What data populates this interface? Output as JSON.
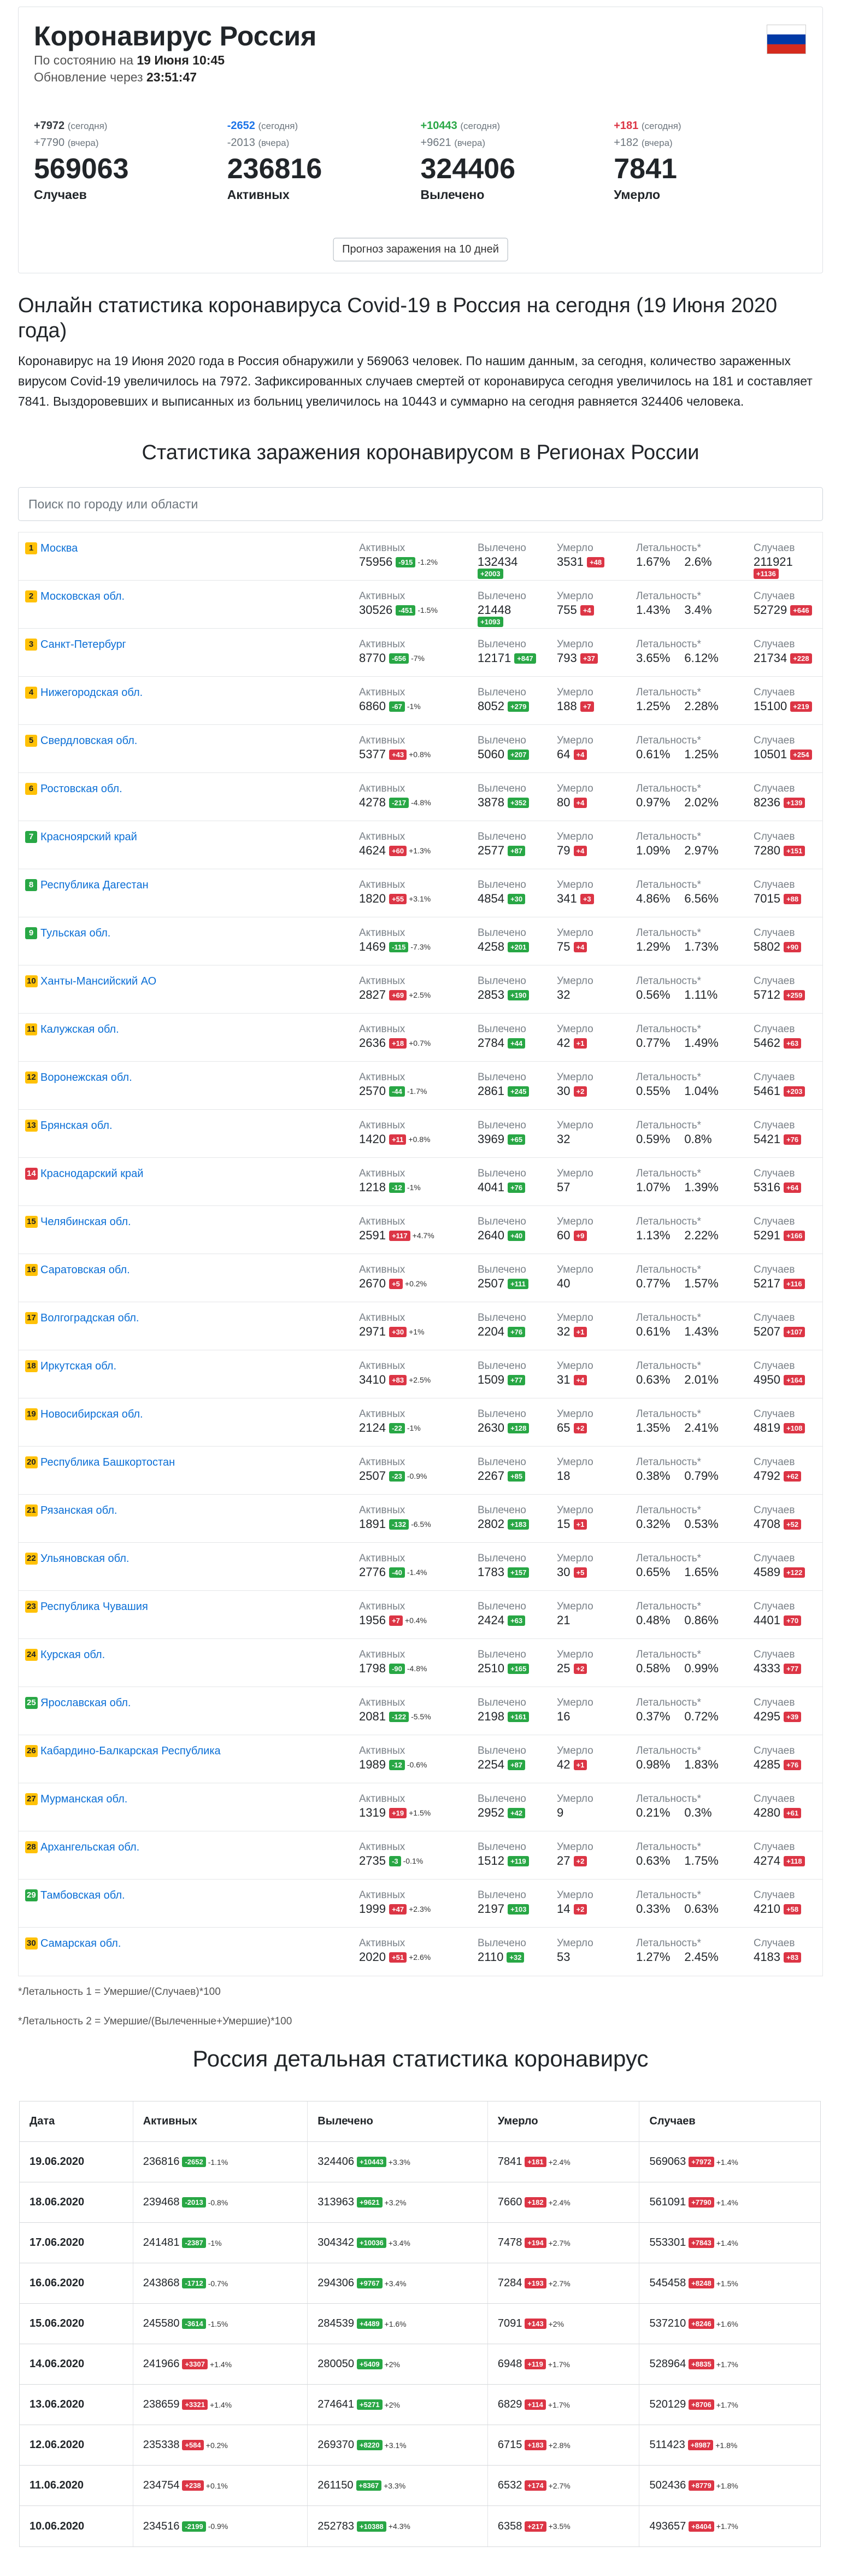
{
  "header": {
    "title": "Коронавирус Россия",
    "as_of_prefix": "По состоянию на",
    "as_of_value": "19 Июня 10:45",
    "update_prefix": "Обновление через",
    "update_value": "23:51:47",
    "flag_colors": [
      "#ffffff",
      "#0039a6",
      "#d52b1e"
    ]
  },
  "stats": [
    {
      "today": "+7972",
      "today_tag": "(сегодня)",
      "yesterday": "+7790",
      "yesterday_tag": "(вчера)",
      "total": "569063",
      "label": "Случаев",
      "color": "#343a40"
    },
    {
      "today": "-2652",
      "today_tag": "(сегодня)",
      "yesterday": "-2013",
      "yesterday_tag": "(вчера)",
      "total": "236816",
      "label": "Активных",
      "color": "#1a73e8"
    },
    {
      "today": "+10443",
      "today_tag": "(сегодня)",
      "yesterday": "+9621",
      "yesterday_tag": "(вчера)",
      "total": "324406",
      "label": "Вылечено",
      "color": "#28a745"
    },
    {
      "today": "+181",
      "today_tag": "(сегодня)",
      "yesterday": "+182",
      "yesterday_tag": "(вчера)",
      "total": "7841",
      "label": "Умерло",
      "color": "#dc3545"
    }
  ],
  "forecast_button": "Прогноз заражения на 10 дней",
  "description": {
    "title": "Онлайн статистика коронавируса Covid-19 в Россия на сегодня (19 Июня 2020 года)",
    "text": "Коронавирус на 19 Июня 2020 года в Россия обнаружили у 569063 человек. По нашим данным, за сегодня, количество зараженных вирусом Covid-19 увеличилось на 7972. Зафиксированных случаев смертей от коронавируса сегодня увеличилось на 181 и составляет 7841. Выздоровевших и выписанных из больниц увеличилось на 10443 и суммарно на сегодня равняется 324406 человека."
  },
  "regions_title": "Статистика заражения коронавирусом в Регионах России",
  "search": {
    "placeholder": "Поиск по городу или области"
  },
  "region_labels": {
    "active": "Активных",
    "recovered": "Вылечено",
    "died": "Умерло",
    "lethality": "Летальность*",
    "cases": "Случаев"
  },
  "regions": [
    {
      "rank": "1",
      "rank_color": "yellow",
      "name": "Москва",
      "active": "75956",
      "active_delta": "-915",
      "active_sign": "g",
      "active_pct": "-1.2%",
      "recovered": "132434",
      "recovered_delta": "+2003",
      "recovered_wrap": true,
      "died": "3531",
      "died_delta": "+48",
      "leth1": "1.67%",
      "leth2": "2.6%",
      "cases": "211921",
      "cases_delta": "+1136",
      "cases_wrap": true
    },
    {
      "rank": "2",
      "rank_color": "yellow",
      "name": "Московская обл.",
      "active": "30526",
      "active_delta": "-451",
      "active_sign": "g",
      "active_pct": "-1.5%",
      "recovered": "21448",
      "recovered_delta": "+1093",
      "recovered_wrap": true,
      "died": "755",
      "died_delta": "+4",
      "leth1": "1.43%",
      "leth2": "3.4%",
      "cases": "52729",
      "cases_delta": "+646",
      "cases_wrap": false
    },
    {
      "rank": "3",
      "rank_color": "yellow",
      "name": "Санкт-Петербург",
      "active": "8770",
      "active_delta": "-656",
      "active_sign": "g",
      "active_pct": "-7%",
      "recovered": "12171",
      "recovered_delta": "+847",
      "recovered_wrap": false,
      "died": "793",
      "died_delta": "+37",
      "leth1": "3.65%",
      "leth2": "6.12%",
      "cases": "21734",
      "cases_delta": "+228",
      "cases_wrap": false
    },
    {
      "rank": "4",
      "rank_color": "yellow",
      "name": "Нижегородская обл.",
      "active": "6860",
      "active_delta": "-67",
      "active_sign": "g",
      "active_pct": "-1%",
      "recovered": "8052",
      "recovered_delta": "+279",
      "recovered_wrap": false,
      "died": "188",
      "died_delta": "+7",
      "leth1": "1.25%",
      "leth2": "2.28%",
      "cases": "15100",
      "cases_delta": "+219",
      "cases_wrap": false
    },
    {
      "rank": "5",
      "rank_color": "yellow",
      "name": "Свердловская обл.",
      "active": "5377",
      "active_delta": "+43",
      "active_sign": "r",
      "active_pct": "+0.8%",
      "recovered": "5060",
      "recovered_delta": "+207",
      "recovered_wrap": false,
      "died": "64",
      "died_delta": "+4",
      "leth1": "0.61%",
      "leth2": "1.25%",
      "cases": "10501",
      "cases_delta": "+254",
      "cases_wrap": false
    },
    {
      "rank": "6",
      "rank_color": "yellow",
      "name": "Ростовская обл.",
      "active": "4278",
      "active_delta": "-217",
      "active_sign": "g",
      "active_pct": "-4.8%",
      "recovered": "3878",
      "recovered_delta": "+352",
      "recovered_wrap": false,
      "died": "80",
      "died_delta": "+4",
      "leth1": "0.97%",
      "leth2": "2.02%",
      "cases": "8236",
      "cases_delta": "+139",
      "cases_wrap": false
    },
    {
      "rank": "7",
      "rank_color": "green",
      "name": "Красноярский край",
      "active": "4624",
      "active_delta": "+60",
      "active_sign": "r",
      "active_pct": "+1.3%",
      "recovered": "2577",
      "recovered_delta": "+87",
      "recovered_wrap": false,
      "died": "79",
      "died_delta": "+4",
      "leth1": "1.09%",
      "leth2": "2.97%",
      "cases": "7280",
      "cases_delta": "+151",
      "cases_wrap": false
    },
    {
      "rank": "8",
      "rank_color": "green",
      "name": "Республика Дагестан",
      "active": "1820",
      "active_delta": "+55",
      "active_sign": "r",
      "active_pct": "+3.1%",
      "recovered": "4854",
      "recovered_delta": "+30",
      "recovered_wrap": false,
      "died": "341",
      "died_delta": "+3",
      "leth1": "4.86%",
      "leth2": "6.56%",
      "cases": "7015",
      "cases_delta": "+88",
      "cases_wrap": false
    },
    {
      "rank": "9",
      "rank_color": "green",
      "name": "Тульская обл.",
      "active": "1469",
      "active_delta": "-115",
      "active_sign": "g",
      "active_pct": "-7.3%",
      "recovered": "4258",
      "recovered_delta": "+201",
      "recovered_wrap": false,
      "died": "75",
      "died_delta": "+4",
      "leth1": "1.29%",
      "leth2": "1.73%",
      "cases": "5802",
      "cases_delta": "+90",
      "cases_wrap": false
    },
    {
      "rank": "10",
      "rank_color": "yellow",
      "name": "Ханты-Мансийский АО",
      "active": "2827",
      "active_delta": "+69",
      "active_sign": "r",
      "active_pct": "+2.5%",
      "recovered": "2853",
      "recovered_delta": "+190",
      "recovered_wrap": false,
      "died": "32",
      "died_delta": "",
      "leth1": "0.56%",
      "leth2": "1.11%",
      "cases": "5712",
      "cases_delta": "+259",
      "cases_wrap": false
    },
    {
      "rank": "11",
      "rank_color": "yellow",
      "name": "Калужская обл.",
      "active": "2636",
      "active_delta": "+18",
      "active_sign": "r",
      "active_pct": "+0.7%",
      "recovered": "2784",
      "recovered_delta": "+44",
      "recovered_wrap": false,
      "died": "42",
      "died_delta": "+1",
      "leth1": "0.77%",
      "leth2": "1.49%",
      "cases": "5462",
      "cases_delta": "+63",
      "cases_wrap": false
    },
    {
      "rank": "12",
      "rank_color": "yellow",
      "name": "Воронежская обл.",
      "active": "2570",
      "active_delta": "-44",
      "active_sign": "g",
      "active_pct": "-1.7%",
      "recovered": "2861",
      "recovered_delta": "+245",
      "recovered_wrap": false,
      "died": "30",
      "died_delta": "+2",
      "leth1": "0.55%",
      "leth2": "1.04%",
      "cases": "5461",
      "cases_delta": "+203",
      "cases_wrap": false
    },
    {
      "rank": "13",
      "rank_color": "yellow",
      "name": "Брянская обл.",
      "active": "1420",
      "active_delta": "+11",
      "active_sign": "r",
      "active_pct": "+0.8%",
      "recovered": "3969",
      "recovered_delta": "+65",
      "recovered_wrap": false,
      "died": "32",
      "died_delta": "",
      "leth1": "0.59%",
      "leth2": "0.8%",
      "cases": "5421",
      "cases_delta": "+76",
      "cases_wrap": false
    },
    {
      "rank": "14",
      "rank_color": "red",
      "name": "Краснодарский край",
      "active": "1218",
      "active_delta": "-12",
      "active_sign": "g",
      "active_pct": "-1%",
      "recovered": "4041",
      "recovered_delta": "+76",
      "recovered_wrap": false,
      "died": "57",
      "died_delta": "",
      "leth1": "1.07%",
      "leth2": "1.39%",
      "cases": "5316",
      "cases_delta": "+64",
      "cases_wrap": false
    },
    {
      "rank": "15",
      "rank_color": "yellow",
      "name": "Челябинская обл.",
      "active": "2591",
      "active_delta": "+117",
      "active_sign": "r",
      "active_pct": "+4.7%",
      "recovered": "2640",
      "recovered_delta": "+40",
      "recovered_wrap": false,
      "died": "60",
      "died_delta": "+9",
      "leth1": "1.13%",
      "leth2": "2.22%",
      "cases": "5291",
      "cases_delta": "+166",
      "cases_wrap": false
    },
    {
      "rank": "16",
      "rank_color": "yellow",
      "name": "Саратовская обл.",
      "active": "2670",
      "active_delta": "+5",
      "active_sign": "r",
      "active_pct": "+0.2%",
      "recovered": "2507",
      "recovered_delta": "+111",
      "recovered_wrap": false,
      "died": "40",
      "died_delta": "",
      "leth1": "0.77%",
      "leth2": "1.57%",
      "cases": "5217",
      "cases_delta": "+116",
      "cases_wrap": false
    },
    {
      "rank": "17",
      "rank_color": "yellow",
      "name": "Волгоградская обл.",
      "active": "2971",
      "active_delta": "+30",
      "active_sign": "r",
      "active_pct": "+1%",
      "recovered": "2204",
      "recovered_delta": "+76",
      "recovered_wrap": false,
      "died": "32",
      "died_delta": "+1",
      "leth1": "0.61%",
      "leth2": "1.43%",
      "cases": "5207",
      "cases_delta": "+107",
      "cases_wrap": false
    },
    {
      "rank": "18",
      "rank_color": "yellow",
      "name": "Иркутская обл.",
      "active": "3410",
      "active_delta": "+83",
      "active_sign": "r",
      "active_pct": "+2.5%",
      "recovered": "1509",
      "recovered_delta": "+77",
      "recovered_wrap": false,
      "died": "31",
      "died_delta": "+4",
      "leth1": "0.63%",
      "leth2": "2.01%",
      "cases": "4950",
      "cases_delta": "+164",
      "cases_wrap": false
    },
    {
      "rank": "19",
      "rank_color": "yellow",
      "name": "Новосибирская обл.",
      "active": "2124",
      "active_delta": "-22",
      "active_sign": "g",
      "active_pct": "-1%",
      "recovered": "2630",
      "recovered_delta": "+128",
      "recovered_wrap": false,
      "died": "65",
      "died_delta": "+2",
      "leth1": "1.35%",
      "leth2": "2.41%",
      "cases": "4819",
      "cases_delta": "+108",
      "cases_wrap": false
    },
    {
      "rank": "20",
      "rank_color": "yellow",
      "name": "Республика Башкортостан",
      "active": "2507",
      "active_delta": "-23",
      "active_sign": "g",
      "active_pct": "-0.9%",
      "recovered": "2267",
      "recovered_delta": "+85",
      "recovered_wrap": false,
      "died": "18",
      "died_delta": "",
      "leth1": "0.38%",
      "leth2": "0.79%",
      "cases": "4792",
      "cases_delta": "+62",
      "cases_wrap": false
    },
    {
      "rank": "21",
      "rank_color": "yellow",
      "name": "Рязанская обл.",
      "active": "1891",
      "active_delta": "-132",
      "active_sign": "g",
      "active_pct": "-6.5%",
      "recovered": "2802",
      "recovered_delta": "+183",
      "recovered_wrap": false,
      "died": "15",
      "died_delta": "+1",
      "leth1": "0.32%",
      "leth2": "0.53%",
      "cases": "4708",
      "cases_delta": "+52",
      "cases_wrap": false
    },
    {
      "rank": "22",
      "rank_color": "yellow",
      "name": "Ульяновская обл.",
      "active": "2776",
      "active_delta": "-40",
      "active_sign": "g",
      "active_pct": "-1.4%",
      "recovered": "1783",
      "recovered_delta": "+157",
      "recovered_wrap": false,
      "died": "30",
      "died_delta": "+5",
      "leth1": "0.65%",
      "leth2": "1.65%",
      "cases": "4589",
      "cases_delta": "+122",
      "cases_wrap": false
    },
    {
      "rank": "23",
      "rank_color": "yellow",
      "name": "Республика Чувашия",
      "active": "1956",
      "active_delta": "+7",
      "active_sign": "r",
      "active_pct": "+0.4%",
      "recovered": "2424",
      "recovered_delta": "+63",
      "recovered_wrap": false,
      "died": "21",
      "died_delta": "",
      "leth1": "0.48%",
      "leth2": "0.86%",
      "cases": "4401",
      "cases_delta": "+70",
      "cases_wrap": false
    },
    {
      "rank": "24",
      "rank_color": "yellow",
      "name": "Курская обл.",
      "active": "1798",
      "active_delta": "-90",
      "active_sign": "g",
      "active_pct": "-4.8%",
      "recovered": "2510",
      "recovered_delta": "+165",
      "recovered_wrap": false,
      "died": "25",
      "died_delta": "+2",
      "leth1": "0.58%",
      "leth2": "0.99%",
      "cases": "4333",
      "cases_delta": "+77",
      "cases_wrap": false
    },
    {
      "rank": "25",
      "rank_color": "green",
      "name": "Ярославская обл.",
      "active": "2081",
      "active_delta": "-122",
      "active_sign": "g",
      "active_pct": "-5.5%",
      "recovered": "2198",
      "recovered_delta": "+161",
      "recovered_wrap": false,
      "died": "16",
      "died_delta": "",
      "leth1": "0.37%",
      "leth2": "0.72%",
      "cases": "4295",
      "cases_delta": "+39",
      "cases_wrap": false
    },
    {
      "rank": "26",
      "rank_color": "yellow",
      "name": "Кабардино-Балкарская Республика",
      "active": "1989",
      "active_delta": "-12",
      "active_sign": "g",
      "active_pct": "-0.6%",
      "recovered": "2254",
      "recovered_delta": "+87",
      "recovered_wrap": false,
      "died": "42",
      "died_delta": "+1",
      "leth1": "0.98%",
      "leth2": "1.83%",
      "cases": "4285",
      "cases_delta": "+76",
      "cases_wrap": false
    },
    {
      "rank": "27",
      "rank_color": "yellow",
      "name": "Мурманская обл.",
      "active": "1319",
      "active_delta": "+19",
      "active_sign": "r",
      "active_pct": "+1.5%",
      "recovered": "2952",
      "recovered_delta": "+42",
      "recovered_wrap": false,
      "died": "9",
      "died_delta": "",
      "leth1": "0.21%",
      "leth2": "0.3%",
      "cases": "4280",
      "cases_delta": "+61",
      "cases_wrap": false
    },
    {
      "rank": "28",
      "rank_color": "yellow",
      "name": "Архангельская обл.",
      "active": "2735",
      "active_delta": "-3",
      "active_sign": "g",
      "active_pct": "-0.1%",
      "recovered": "1512",
      "recovered_delta": "+119",
      "recovered_wrap": false,
      "died": "27",
      "died_delta": "+2",
      "leth1": "0.63%",
      "leth2": "1.75%",
      "cases": "4274",
      "cases_delta": "+118",
      "cases_wrap": false
    },
    {
      "rank": "29",
      "rank_color": "green",
      "name": "Тамбовская обл.",
      "active": "1999",
      "active_delta": "+47",
      "active_sign": "r",
      "active_pct": "+2.3%",
      "recovered": "2197",
      "recovered_delta": "+103",
      "recovered_wrap": false,
      "died": "14",
      "died_delta": "+2",
      "leth1": "0.33%",
      "leth2": "0.63%",
      "cases": "4210",
      "cases_delta": "+58",
      "cases_wrap": false
    },
    {
      "rank": "30",
      "rank_color": "yellow",
      "name": "Самарская обл.",
      "active": "2020",
      "active_delta": "+51",
      "active_sign": "r",
      "active_pct": "+2.6%",
      "recovered": "2110",
      "recovered_delta": "+32",
      "recovered_wrap": false,
      "died": "53",
      "died_delta": "",
      "leth1": "1.27%",
      "leth2": "2.45%",
      "cases": "4183",
      "cases_delta": "+83",
      "cases_wrap": false
    }
  ],
  "notes": [
    "*Летальность 1 = Умершие/(Случаев)*100",
    "*Летальность 2 = Умершие/(Вылеченные+Умершие)*100"
  ],
  "detail_title": "Россия детальная статистика коронавирус",
  "detail_headers": [
    "Дата",
    "Активных",
    "Вылечено",
    "Умерло",
    "Случаев"
  ],
  "detail_rows": [
    {
      "date": "19.06.2020",
      "active": "236816",
      "active_d": "-2652",
      "active_s": "g",
      "active_p": "-1.1%",
      "rec": "324406",
      "rec_d": "+10443",
      "rec_p": "+3.3%",
      "died": "7841",
      "died_d": "+181",
      "died_p": "+2.4%",
      "cases": "569063",
      "cases_d": "+7972",
      "cases_p": "+1.4%"
    },
    {
      "date": "18.06.2020",
      "active": "239468",
      "active_d": "-2013",
      "active_s": "g",
      "active_p": "-0.8%",
      "rec": "313963",
      "rec_d": "+9621",
      "rec_p": "+3.2%",
      "died": "7660",
      "died_d": "+182",
      "died_p": "+2.4%",
      "cases": "561091",
      "cases_d": "+7790",
      "cases_p": "+1.4%"
    },
    {
      "date": "17.06.2020",
      "active": "241481",
      "active_d": "-2387",
      "active_s": "g",
      "active_p": "-1%",
      "rec": "304342",
      "rec_d": "+10036",
      "rec_p": "+3.4%",
      "died": "7478",
      "died_d": "+194",
      "died_p": "+2.7%",
      "cases": "553301",
      "cases_d": "+7843",
      "cases_p": "+1.4%"
    },
    {
      "date": "16.06.2020",
      "active": "243868",
      "active_d": "-1712",
      "active_s": "g",
      "active_p": "-0.7%",
      "rec": "294306",
      "rec_d": "+9767",
      "rec_p": "+3.4%",
      "died": "7284",
      "died_d": "+193",
      "died_p": "+2.7%",
      "cases": "545458",
      "cases_d": "+8248",
      "cases_p": "+1.5%"
    },
    {
      "date": "15.06.2020",
      "active": "245580",
      "active_d": "-3614",
      "active_s": "g",
      "active_p": "-1.5%",
      "rec": "284539",
      "rec_d": "+4489",
      "rec_p": "+1.6%",
      "died": "7091",
      "died_d": "+143",
      "died_p": "+2%",
      "cases": "537210",
      "cases_d": "+8246",
      "cases_p": "+1.6%"
    },
    {
      "date": "14.06.2020",
      "active": "241966",
      "active_d": "+3307",
      "active_s": "r",
      "active_p": "+1.4%",
      "rec": "280050",
      "rec_d": "+5409",
      "rec_p": "+2%",
      "died": "6948",
      "died_d": "+119",
      "died_p": "+1.7%",
      "cases": "528964",
      "cases_d": "+8835",
      "cases_p": "+1.7%"
    },
    {
      "date": "13.06.2020",
      "active": "238659",
      "active_d": "+3321",
      "active_s": "r",
      "active_p": "+1.4%",
      "rec": "274641",
      "rec_d": "+5271",
      "rec_p": "+2%",
      "died": "6829",
      "died_d": "+114",
      "died_p": "+1.7%",
      "cases": "520129",
      "cases_d": "+8706",
      "cases_p": "+1.7%"
    },
    {
      "date": "12.06.2020",
      "active": "235338",
      "active_d": "+584",
      "active_s": "r",
      "active_p": "+0.2%",
      "rec": "269370",
      "rec_d": "+8220",
      "rec_p": "+3.1%",
      "died": "6715",
      "died_d": "+183",
      "died_p": "+2.8%",
      "cases": "511423",
      "cases_d": "+8987",
      "cases_p": "+1.8%"
    },
    {
      "date": "11.06.2020",
      "active": "234754",
      "active_d": "+238",
      "active_s": "r",
      "active_p": "+0.1%",
      "rec": "261150",
      "rec_d": "+8367",
      "rec_p": "+3.3%",
      "died": "6532",
      "died_d": "+174",
      "died_p": "+2.7%",
      "cases": "502436",
      "cases_d": "+8779",
      "cases_p": "+1.8%"
    },
    {
      "date": "10.06.2020",
      "active": "234516",
      "active_d": "-2199",
      "active_s": "g",
      "active_p": "-0.9%",
      "rec": "252783",
      "rec_d": "+10388",
      "rec_p": "+4.3%",
      "died": "6358",
      "died_d": "+217",
      "died_p": "+3.5%",
      "cases": "493657",
      "cases_d": "+8404",
      "cases_p": "+1.7%"
    }
  ]
}
